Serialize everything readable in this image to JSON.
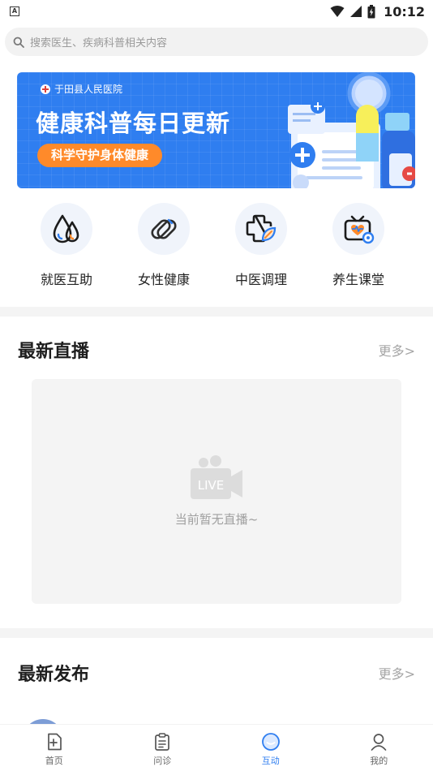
{
  "status_bar": {
    "app_badge": "A",
    "time": "10:12"
  },
  "search": {
    "placeholder": "搜索医生、疾病科普相关内容"
  },
  "banner": {
    "hospital": "于田县人民医院",
    "title": "健康科普每日更新",
    "pill": "科学守护身体健康"
  },
  "quick_links": [
    {
      "label": "就医互助",
      "icon": "water-drops-icon"
    },
    {
      "label": "女性健康",
      "icon": "chain-link-icon"
    },
    {
      "label": "中医调理",
      "icon": "herbal-cross-icon"
    },
    {
      "label": "养生课堂",
      "icon": "tv-heart-icon"
    }
  ],
  "live_section": {
    "title": "最新直播",
    "more": "更多>",
    "camera_badge": "LIVE",
    "empty_text": "当前暂无直播~"
  },
  "release_section": {
    "title": "最新发布",
    "more": "更多>"
  },
  "bottom_nav": {
    "active": "互动",
    "items": [
      {
        "label": "首页",
        "icon": "home-doc-icon"
      },
      {
        "label": "问诊",
        "icon": "clipboard-icon"
      },
      {
        "label": "互动",
        "icon": "chat-bubble-icon"
      },
      {
        "label": "我的",
        "icon": "user-icon"
      }
    ]
  },
  "colors": {
    "brand_blue": "#2f7ef0",
    "accent_orange": "#ff8a2a"
  }
}
